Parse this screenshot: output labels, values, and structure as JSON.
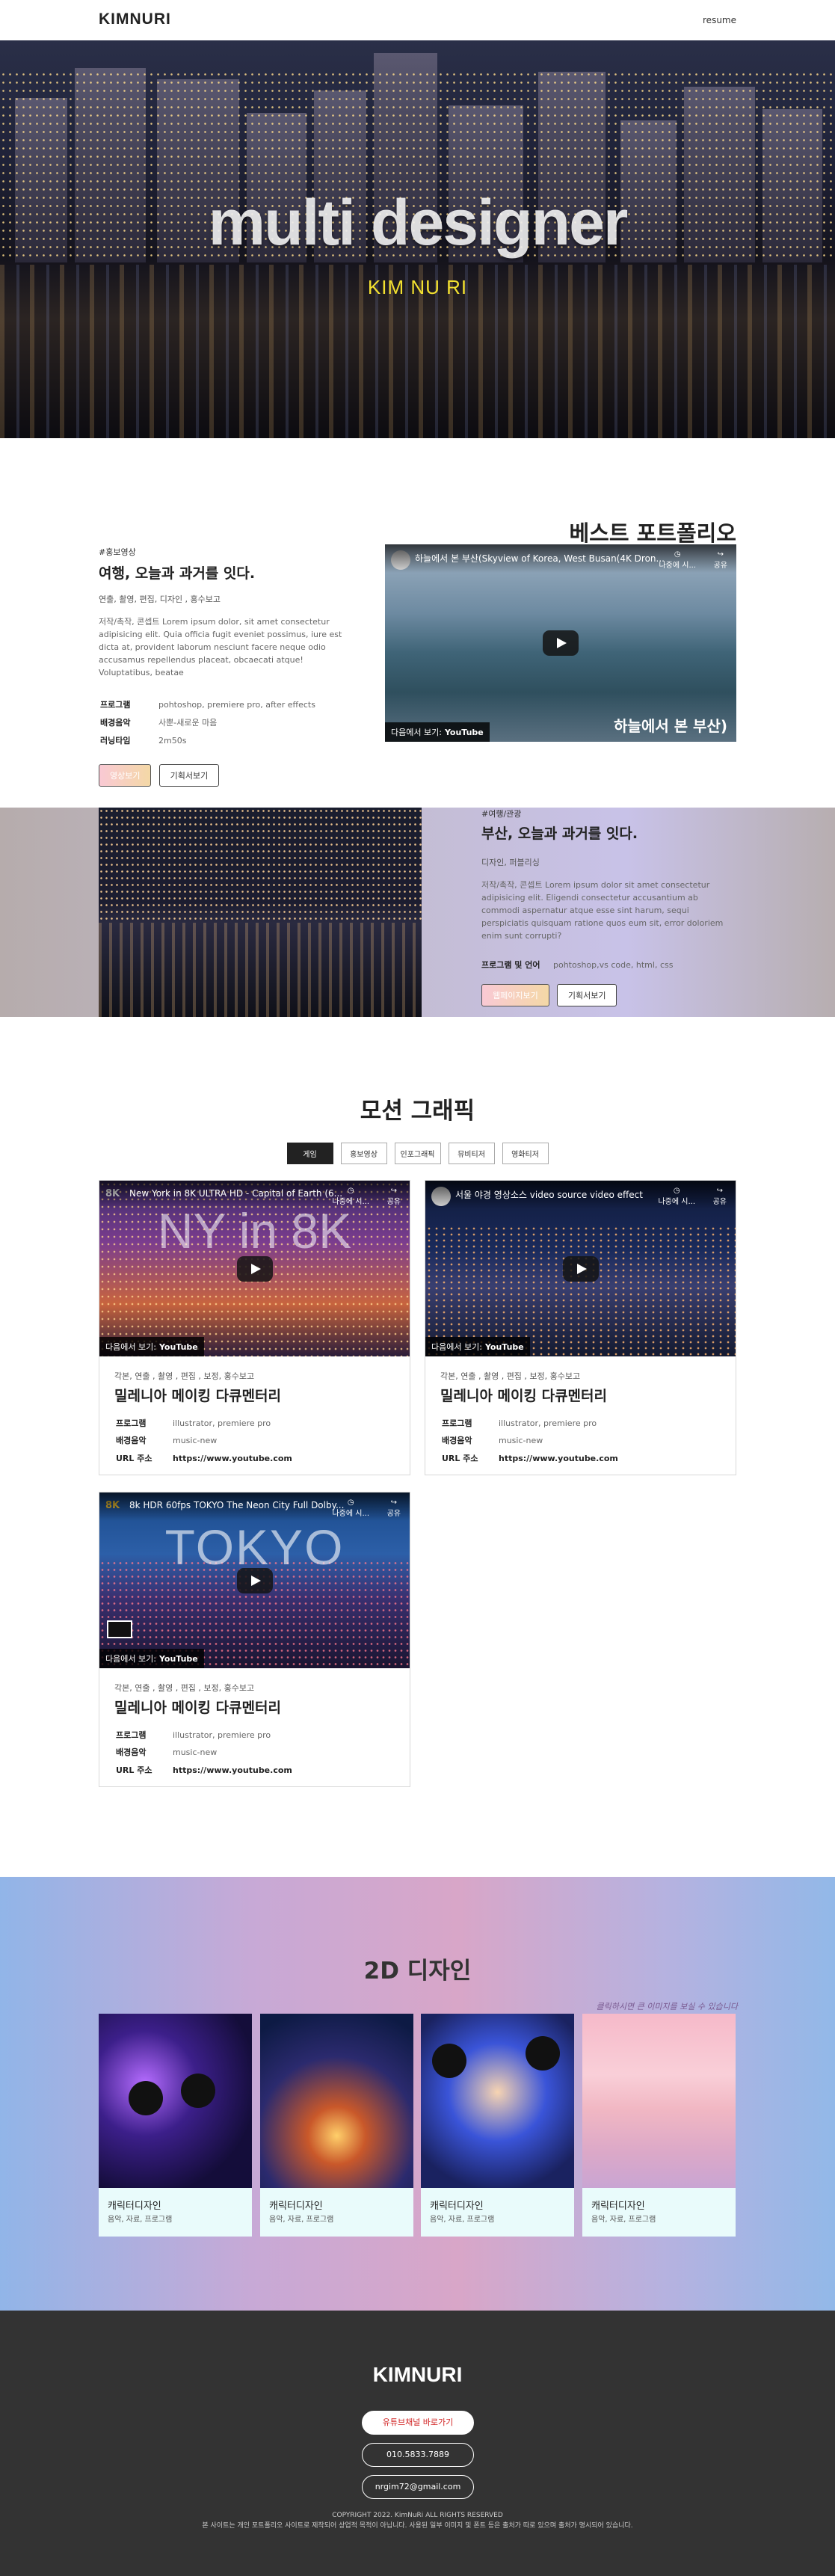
{
  "nav": {
    "logo": "KIMNURI",
    "link": "resume"
  },
  "hero": {
    "title": "multi designer",
    "subtitle": "KIM NU RI"
  },
  "best": {
    "section_title": "베스트 포트폴리오",
    "tag": "#홍보영상",
    "heading": "여행, 오늘과 과거를 잇다.",
    "meta": "연출, 촬영, 편집, 디자인 , 홍수보고",
    "desc": "저작/촉작, 콘셉트 Lorem ipsum dolor, sit amet consectetur adipisicing elit. Quia officia fugit eveniet possimus, iure est dicta at, provident laborum nesciunt facere neque odio accusamus repellendus placeat, obcaecati atque! Voluptatibus, beatae",
    "spec": [
      {
        "k": "프로그램",
        "v": "pohtoshop, premiere pro, after effects"
      },
      {
        "k": "배경음악",
        "v": "사뿐-새로운 마음"
      },
      {
        "k": "러닝타임",
        "v": "2m50s"
      }
    ],
    "btn_primary": "영상보기",
    "btn_secondary": "기획서보기",
    "video": {
      "title": "하늘에서 본 부산(Skyview of Korea, West Busan(4K Dron...",
      "later": "나중에 시...",
      "share": "공유",
      "watch": "다음에서 보기:",
      "yt": "YouTube",
      "caption": "하늘에서 본 부산)"
    }
  },
  "busan": {
    "tag": "#여행/관광",
    "heading": "부산, 오늘과 과거를 잇다.",
    "meta": "디자인, 퍼블리싱",
    "desc": "저작/촉작, 콘셉트 Lorem ipsum dolor sit amet consectetur adipisicing elit. Eligendi consectetur accusantium ab commodi aspernatur atque esse sint harum, sequi perspiciatis quisquam ratione quos eum sit, error doloriem enim sunt corrupti?",
    "spec_k": "프로그램 및 언어",
    "spec_v": "pohtoshop,vs code, html, css",
    "btn_primary": "웹페이지보기",
    "btn_secondary": "기획서보기"
  },
  "motion": {
    "title": "모션 그래픽",
    "tabs": [
      "게임",
      "홍보영상",
      "인포그래픽",
      "뮤비티저",
      "영화티저"
    ],
    "cards": [
      {
        "video_title": "New York in 8K ULTRA HD - Capital of Earth (6...",
        "badge": "8K",
        "tag": "각본, 연출 , 촬영 , 편집 , 보정, 홍수보고",
        "heading": "밀레니아 메이킹 다큐멘터리",
        "program": "illustrator, premiere pro",
        "music": "music-new",
        "url": "https://www.youtube.com",
        "overlay": "NY in 8K"
      },
      {
        "video_title": "서울 야경 영상소스 video source video effect",
        "badge": "",
        "tag": "각본, 연출 , 촬영 , 편집 , 보정, 홍수보고",
        "heading": "밀레니아 메이킹 다큐멘터리",
        "program": "illustrator, premiere pro",
        "music": "music-new",
        "url": "https://www.youtube.com",
        "overlay": ""
      },
      {
        "video_title": "8k HDR 60fps TOKYO The Neon City Full Dolby...",
        "badge": "8K",
        "tag": "각본, 연출 , 촬영 , 편집 , 보정, 홍수보고",
        "heading": "밀레니아 메이킹 다큐멘터리",
        "program": "illustrator, premiere pro",
        "music": "music-new",
        "url": "https://www.youtube.com",
        "overlay": "TOKYO"
      }
    ],
    "labels": {
      "program": "프로그램",
      "music": "배경음악",
      "url": "URL 주소",
      "later": "나중에 시...",
      "share": "공유",
      "watch": "다음에서 보기:",
      "yt": "YouTube"
    }
  },
  "twoD": {
    "title": "2D 디자인",
    "hint": "클릭하시면 큰 이미지를 보실 수 있습니다",
    "cards": [
      {
        "title": "캐릭터디자인",
        "sub": "음악, 자료, 프로그램"
      },
      {
        "title": "캐릭터디자인",
        "sub": "음악, 자료, 프로그램"
      },
      {
        "title": "캐릭터디자인",
        "sub": "음악, 자료, 프로그램"
      },
      {
        "title": "캐릭터디자인",
        "sub": "음악, 자료, 프로그램"
      }
    ]
  },
  "footer": {
    "logo": "KIMNURI",
    "youtube": "유튜브채널 바로가기",
    "phone": "010.5833.7889",
    "email": "nrgim72@gmail.com",
    "copyright": "COPYRIGHT 2022. KimNuRi ALL RIGHTS RESERVED",
    "notice": "본 사이트는 개인 포트폴리오 사이트로 제작되어 상업적 목적이 아닙니다. 사용된 일부 이미지 및 폰트 등은 출처가 따로 있으며 출처가 명시되어 있습니다."
  }
}
